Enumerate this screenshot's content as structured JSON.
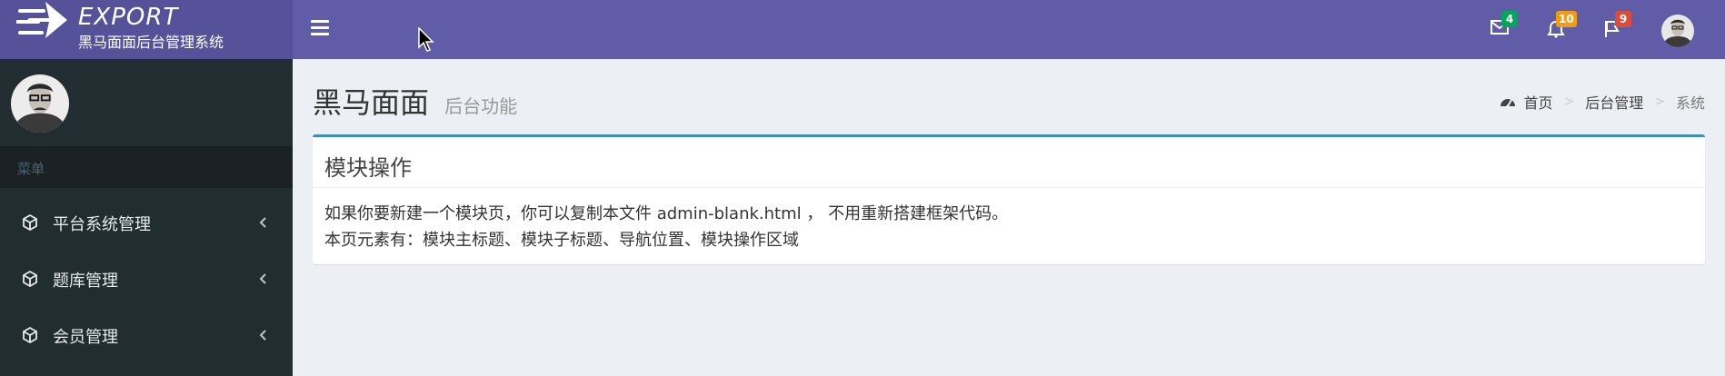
{
  "header": {
    "logo_title": "EXPORT",
    "logo_subtitle": "黑马面面后台管理系统",
    "brand_color": "#555299",
    "navbar_color": "#605ca8",
    "notifications": [
      {
        "icon": "envelope-icon",
        "count": "4",
        "color": "#00a65a"
      },
      {
        "icon": "bell-icon",
        "count": "10",
        "color": "#f39c12"
      },
      {
        "icon": "flag-icon",
        "count": "9",
        "color": "#dd4b39"
      }
    ]
  },
  "sidebar": {
    "menu_header": "菜单",
    "items": [
      {
        "label": "平台系统管理",
        "icon": "cube-icon"
      },
      {
        "label": "题库管理",
        "icon": "cube-icon"
      },
      {
        "label": "会员管理",
        "icon": "cube-icon"
      }
    ]
  },
  "content": {
    "title": "黑马面面",
    "subtitle": "后台功能",
    "breadcrumb": [
      {
        "label": "首页",
        "icon": "dashboard-icon"
      },
      {
        "label": "后台管理"
      },
      {
        "label": "系统"
      }
    ],
    "box": {
      "title": "模块操作",
      "lines": [
        "如果你要新建一个模块页，你可以复制本文件 admin-blank.html ，  不用重新搭建框架代码。",
        "本页元素有：模块主标题、模块子标题、导航位置、模块操作区域"
      ],
      "border_color": "#3c8dbc"
    }
  }
}
